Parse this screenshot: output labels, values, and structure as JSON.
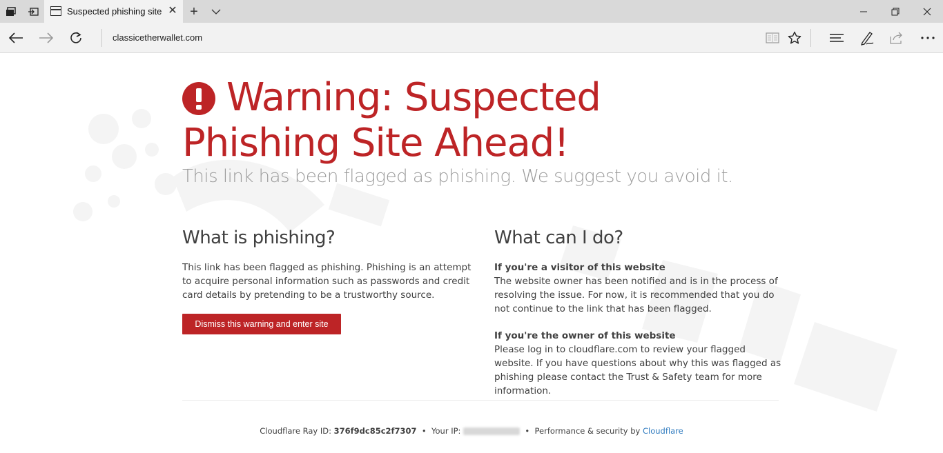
{
  "browser": {
    "tab": {
      "title": "Suspected phishing site"
    },
    "address": "classicetherwallet.com"
  },
  "page": {
    "headline": "Warning: Suspected Phishing Site Ahead!",
    "subline": "This link has been flagged as phishing. We suggest you avoid it.",
    "left": {
      "heading": "What is phishing?",
      "body": "This link has been flagged as phishing. Phishing is an attempt to acquire personal information such as passwords and credit card details by pretending to be a trustworthy source.",
      "button": "Dismiss this warning and enter site"
    },
    "right": {
      "heading": "What can I do?",
      "visitor_head": "If you're a visitor of this website",
      "visitor_body": "The website owner has been notified and is in the process of resolving the issue. For now, it is recommended that you do not continue to the link that has been flagged.",
      "owner_head": "If you're the owner of this website",
      "owner_body": "Please log in to cloudflare.com to review your flagged website. If you have questions about why this was flagged as phishing please contact the Trust & Safety team for more information."
    },
    "footer": {
      "ray_label": "Cloudflare Ray ID:",
      "ray_id": "376f9dc85c2f7307",
      "ip_label": "Your IP:",
      "perf_label": "Performance & security by",
      "perf_link": "Cloudflare"
    }
  },
  "colors": {
    "accent": "#bd2426",
    "link": "#2f7bbf"
  }
}
